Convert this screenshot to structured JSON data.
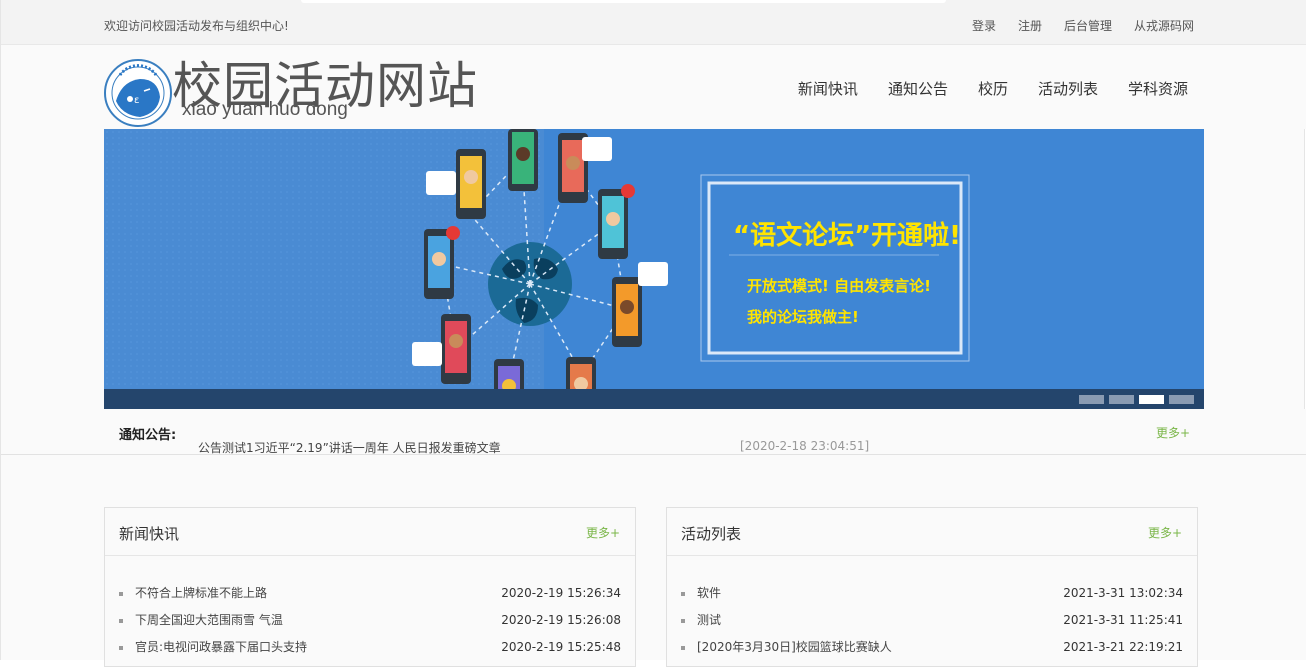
{
  "topbar": {
    "welcome": "欢迎访问校园活动发布与组织中心!",
    "links": [
      "登录",
      "注册",
      "后台管理",
      "从戎源码网"
    ]
  },
  "header": {
    "title": "校园活动网站",
    "subtitle": "xiao yuan huo dong",
    "nav": [
      "新闻快讯",
      "通知公告",
      "校历",
      "活动列表",
      "学科资源"
    ]
  },
  "banner": {
    "headline": "“语文论坛”开通啦!",
    "line1": "开放式模式!  自由发表言论!",
    "line2": "我的论坛我做主!",
    "slides": 4,
    "active_slide": 3
  },
  "notice": {
    "label": "通知公告:",
    "text": "公告测试1习近平“2.19”讲话一周年 人民日报发重磅文章",
    "date": "[2020-2-18 23:04:51]",
    "more": "更多+"
  },
  "news": {
    "title": "新闻快讯",
    "more": "更多+",
    "items": [
      {
        "title": "不符合上牌标准不能上路",
        "date": "2020-2-19 15:26:34"
      },
      {
        "title": "下周全国迎大范围雨雪 气温",
        "date": "2020-2-19 15:26:08"
      },
      {
        "title": "官员:电视问政暴露下届口头支持",
        "date": "2020-2-19 15:25:48"
      }
    ]
  },
  "activities": {
    "title": "活动列表",
    "more": "更多+",
    "items": [
      {
        "title": "软件",
        "date": "2021-3-31 13:02:34"
      },
      {
        "title": "测试",
        "date": "2021-3-31 11:25:41"
      },
      {
        "title": "[2020年3月30日]校园篮球比赛缺人",
        "date": "2021-3-21 22:19:21"
      }
    ]
  },
  "colors": {
    "accent_green": "#7ab648",
    "banner_blue": "#4a8ed6",
    "promo_yellow": "#ffe400"
  }
}
